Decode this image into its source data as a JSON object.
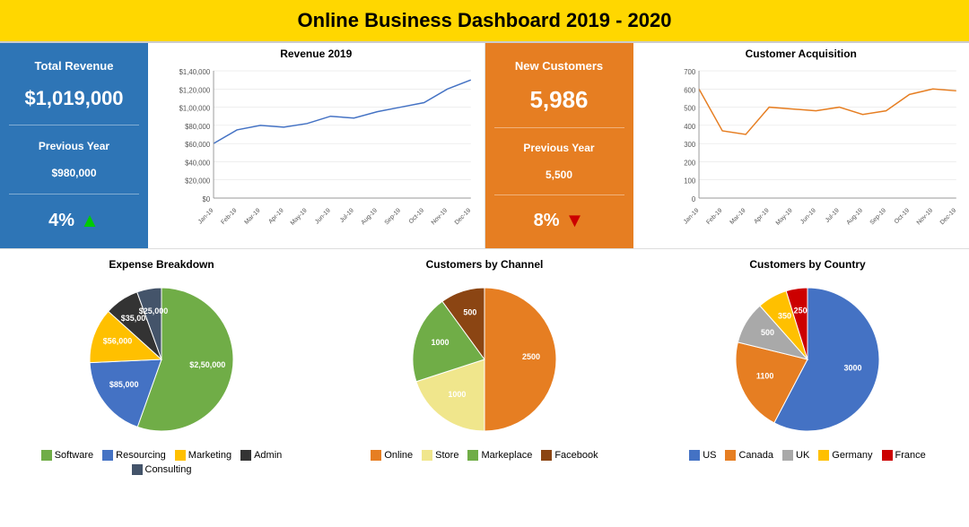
{
  "header": {
    "title": "Online Business Dashboard 2019 - 2020"
  },
  "kpi": {
    "total_revenue_label": "Total Revenue",
    "total_revenue_value": "$1,019,000",
    "prev_year_label": "Previous Year",
    "prev_year_value": "$980,000",
    "change_pct": "4%",
    "new_customers_label": "New Customers",
    "new_customers_value": "5,986",
    "nc_prev_label": "Previous Year",
    "nc_prev_value": "5,500",
    "nc_change_pct": "8%"
  },
  "revenue_chart": {
    "title": "Revenue 2019",
    "months": [
      "Jan-19",
      "Feb-19",
      "Mar-19",
      "Apr-19",
      "May-19",
      "Jun-19",
      "Jul-19",
      "Aug-19",
      "Sep-19",
      "Oct-19",
      "Nov-19",
      "Dec-19"
    ],
    "values": [
      60000,
      75000,
      80000,
      78000,
      82000,
      90000,
      88000,
      95000,
      100000,
      105000,
      120000,
      130000
    ],
    "y_labels": [
      "$1,40,000",
      "$1,20,000",
      "$1,00,000",
      "$80,000",
      "$60,000",
      "$40,000",
      "$20,000",
      "$0"
    ]
  },
  "customer_chart": {
    "title": "Customer Acquisition",
    "months": [
      "Jan-19",
      "Feb-19",
      "Mar-19",
      "Apr-19",
      "May-19",
      "Jun-19",
      "Jul-19",
      "Aug-19",
      "Sep-19",
      "Oct-19",
      "Nov-19",
      "Dec-19"
    ],
    "values": [
      600,
      370,
      350,
      500,
      490,
      480,
      500,
      460,
      480,
      570,
      600,
      590
    ],
    "y_labels": [
      "700",
      "600",
      "500",
      "400",
      "300",
      "200",
      "100",
      "0"
    ]
  },
  "expense_pie": {
    "title": "Expense Breakdown",
    "segments": [
      {
        "label": "Software",
        "value": 250000,
        "display": "$2,50,000",
        "color": "#70AD47"
      },
      {
        "label": "Resourcing",
        "value": 85000,
        "display": "$85,000",
        "color": "#4472C4"
      },
      {
        "label": "Marketing",
        "value": 56000,
        "display": "$56,000",
        "color": "#FFC000"
      },
      {
        "label": "Admin",
        "value": 35000,
        "display": "$35,000",
        "color": "#333333"
      },
      {
        "label": "Consulting",
        "value": 25000,
        "display": "$25,000",
        "color": "#44546A"
      }
    ]
  },
  "channel_pie": {
    "title": "Customers by Channel",
    "segments": [
      {
        "label": "Online",
        "value": 2500,
        "display": "2500",
        "color": "#E67E22"
      },
      {
        "label": "Store",
        "value": 1000,
        "display": "1000",
        "color": "#F0E68C"
      },
      {
        "label": "Markeplace",
        "value": 1000,
        "display": "1000",
        "color": "#70AD47"
      },
      {
        "label": "Facebook",
        "value": 500,
        "display": "500",
        "color": "#8B4513"
      }
    ]
  },
  "country_pie": {
    "title": "Customers by Country",
    "segments": [
      {
        "label": "US",
        "value": 3000,
        "display": "3000",
        "color": "#4472C4"
      },
      {
        "label": "Canada",
        "value": 1100,
        "display": "1100",
        "color": "#E67E22"
      },
      {
        "label": "UK",
        "value": 500,
        "display": "500",
        "color": "#A9A9A9"
      },
      {
        "label": "Germany",
        "value": 350,
        "display": "350",
        "color": "#FFC000"
      },
      {
        "label": "France",
        "value": 250,
        "display": "250",
        "color": "#CC0000"
      }
    ]
  }
}
